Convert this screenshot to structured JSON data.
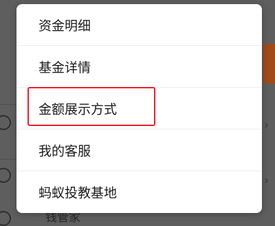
{
  "menu": {
    "items": [
      {
        "label": "资金明细"
      },
      {
        "label": "基金详情"
      },
      {
        "label": "金额展示方式"
      },
      {
        "label": "我的客服"
      },
      {
        "label": "蚂蚁投教基地"
      }
    ]
  },
  "background": {
    "partial_label": "钱管家",
    "chevron_glyph": "›"
  },
  "colors": {
    "overlay": "#5e5e5e",
    "highlight": "#e8202a",
    "accent": "#a14a1a"
  }
}
